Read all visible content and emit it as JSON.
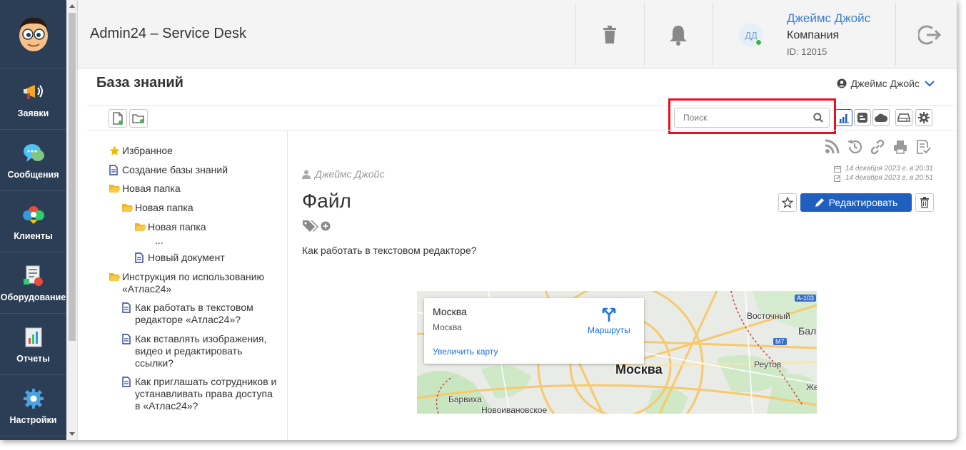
{
  "app": {
    "title": "Admin24 – Service Desk"
  },
  "sidebar": {
    "items": [
      {
        "label": "Заявки",
        "icon": "megaphone-icon"
      },
      {
        "label": "Сообщения",
        "icon": "chat-icon"
      },
      {
        "label": "Клиенты",
        "icon": "clients-icon"
      },
      {
        "label": "Оборудование",
        "icon": "equipment-icon"
      },
      {
        "label": "Отчеты",
        "icon": "reports-icon"
      },
      {
        "label": "Настройки",
        "icon": "gear-icon"
      }
    ]
  },
  "header": {
    "avatar_initials": "ДД",
    "user_name": "Джеймс Джойс",
    "company": "Компания",
    "user_id": "ID: 12015"
  },
  "page": {
    "title": "База знаний",
    "current_user": "Джеймс Джойс"
  },
  "search": {
    "placeholder": "Поиск",
    "value": ""
  },
  "tree": {
    "items": [
      {
        "label": "Избранное",
        "icon": "star-icon"
      },
      {
        "label": "Создание базы знаний",
        "icon": "document-icon"
      },
      {
        "label": "Новая папка",
        "icon": "folder-open-icon"
      },
      {
        "label": "Новая папка",
        "icon": "folder-open-icon"
      },
      {
        "label": "Новая папка",
        "icon": "folder-open-icon"
      },
      {
        "label": "...",
        "icon": ""
      },
      {
        "label": "Новый документ",
        "icon": "document-icon"
      },
      {
        "label": "Инструкция по использованию\n«Атлас24»",
        "icon": "folder-open-icon"
      },
      {
        "label": "Как работать в текстовом\nредакторе «Атлас24»?",
        "icon": "document-icon"
      },
      {
        "label": "Как вставлять изображения,\nвидео и редактировать\nссылки?",
        "icon": "document-icon"
      },
      {
        "label": "Как приглашать сотрудников и\nустанавливать права доступа\nв «Атлас24»?",
        "icon": "document-icon"
      }
    ]
  },
  "article": {
    "author": "Джеймс Джойс",
    "created": "14 декабря 2023 г. в 20:31",
    "edited": "14 декабря 2023 г. в 20:51",
    "title": "Файл",
    "edit_label": "Редактировать",
    "question": "Как работать в текстовом редакторе?"
  },
  "map": {
    "card_title": "Москва",
    "card_subtitle": "Москва",
    "enlarge_link": "Увеличить карту",
    "routes_label": "Маршруты",
    "city_label": "Москва",
    "labels": {
      "vostochny": "Восточный",
      "reutov": "Реутов",
      "barvikha": "Барвиха",
      "novoivanovskoe": "Новоивановское",
      "bal": "Бал",
      "zhe": "Же"
    },
    "road_badges": {
      "a103": "A-103",
      "m7": "M7"
    }
  },
  "colors": {
    "sidebar_bg": "#2c3e55",
    "accent": "#1f5fbf",
    "highlight": "#e8101c",
    "link": "#3a7dd4"
  }
}
